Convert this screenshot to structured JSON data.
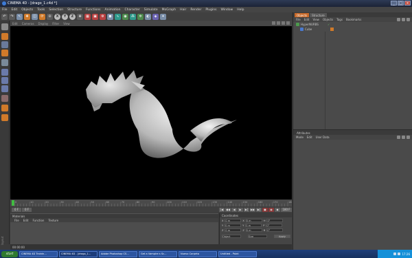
{
  "window": {
    "title": "CINEMA 4D - [drago_1.c4d *]"
  },
  "menu": [
    "File",
    "Edit",
    "Objects",
    "Tools",
    "Selection",
    "Structure",
    "Functions",
    "Animation",
    "Character",
    "Simulate",
    "MoGraph",
    "Hair",
    "Render",
    "Plugins",
    "Window",
    "Help"
  ],
  "toolbar": {
    "x": "X",
    "y": "Y",
    "z": "Z"
  },
  "viewport": {
    "menu": [
      "Edit",
      "Cameras",
      "Display",
      "Filter",
      "View"
    ]
  },
  "timeline": {
    "ticks": [
      "0",
      "10",
      "20",
      "30",
      "40",
      "50",
      "60",
      "70",
      "80",
      "90",
      "100",
      "110",
      "120",
      "130",
      "140",
      "150",
      "160",
      "170",
      "180"
    ],
    "current_frame": "0 F",
    "start_field": "0 F",
    "end_field": "180 F"
  },
  "materials": {
    "title": "Materials",
    "menu": [
      "File",
      "Edit",
      "Function",
      "Texture"
    ]
  },
  "coordinates": {
    "title": "Coordinates",
    "rows": [
      {
        "a": "X",
        "b": "0 m",
        "c": "X",
        "d": "0 m",
        "e": "H",
        "f": "0°"
      },
      {
        "a": "Y",
        "b": "0 m",
        "c": "Y",
        "d": "0 m",
        "e": "P",
        "f": "0°"
      },
      {
        "a": "Z",
        "b": "0 m",
        "c": "Z",
        "d": "0 m",
        "e": "B",
        "f": "0°"
      }
    ],
    "mode_select": "Object",
    "size_select": "Size",
    "apply": "Apply"
  },
  "status": {
    "text": "00:00:00"
  },
  "objects_panel": {
    "tabs": [
      "Objects",
      "Structure"
    ],
    "menu": [
      "File",
      "Edit",
      "View",
      "Objects",
      "Tags",
      "Bookmarks"
    ],
    "items": [
      "HyperNURBS",
      "Cube"
    ]
  },
  "attributes_panel": {
    "title": "Attributes",
    "menu": [
      "Mode",
      "Edit",
      "User Data"
    ]
  },
  "layout_label": "layout",
  "taskbar": {
    "start": "start",
    "tasks": [
      "CINEMA 4D Trainin...",
      "CINEMA 4D - [drago_1...",
      "Adobe Photoshop CS...",
      "Get a Vampire s Sc...",
      "Nuevo Carpeta",
      "Untitled - Paint"
    ],
    "clock": "17:26"
  }
}
